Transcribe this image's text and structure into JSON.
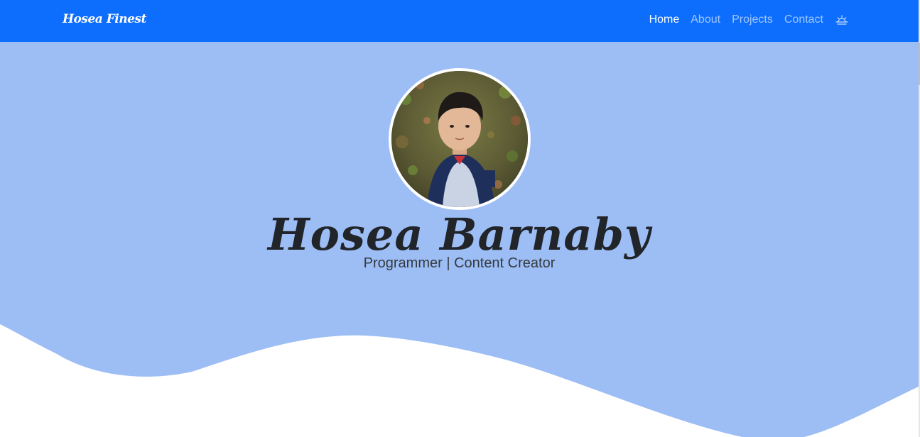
{
  "navbar": {
    "brand": "Hosea Finest",
    "links": [
      {
        "label": "Home",
        "active": true
      },
      {
        "label": "About",
        "active": false
      },
      {
        "label": "Projects",
        "active": false
      },
      {
        "label": "Contact",
        "active": false
      }
    ],
    "theme_toggle_icon": "sunrise-icon"
  },
  "hero": {
    "name": "Hosea Barnaby",
    "subtitle": "Programmer | Content Creator",
    "avatar_icon": "profile-photo"
  },
  "colors": {
    "navbar_bg": "#0d6efd",
    "hero_bg": "#9dbdf5",
    "page_bg": "#ffffff",
    "text_dark": "#212529"
  }
}
